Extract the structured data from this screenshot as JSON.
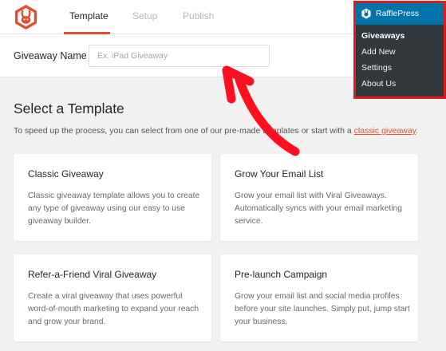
{
  "colors": {
    "accent": "#e34f2a",
    "wp_blue": "#0073aa",
    "wp_dark": "#32373c",
    "highlight_red": "#e01b1b"
  },
  "nav": {
    "tabs": [
      {
        "label": "Template",
        "active": true
      },
      {
        "label": "Setup",
        "active": false
      },
      {
        "label": "Publish",
        "active": false
      }
    ]
  },
  "name_field": {
    "label": "Giveaway Name",
    "value": "",
    "placeholder": "Ex. iPad Giveaway"
  },
  "templates": {
    "title": "Select a Template",
    "description_prefix": "To speed up the process, you can select from one of our pre-made templates or start with a",
    "description_link": "classic giveaway",
    "description_suffix": ".",
    "cards": [
      {
        "title": "Classic Giveaway",
        "description": "Classic giveaway template allows you to create any type of giveaway using our easy to use giveaway builder."
      },
      {
        "title": "Grow Your Email List",
        "description": "Grow your email list with Viral Giveaways. Automatically syncs with your email marketing service."
      },
      {
        "title": "Refer-a-Friend Viral Giveaway",
        "description": "Create a viral giveaway that uses powerful word-of-mouth marketing to expand your reach and grow your brand."
      },
      {
        "title": "Pre-launch Campaign",
        "description": "Grow your email list and social media profiles before your site launches. Simply put, jump start your business."
      }
    ]
  },
  "wp_menu": {
    "title": "RafflePress",
    "items": [
      {
        "label": "Giveaways",
        "current": true
      },
      {
        "label": "Add New",
        "current": false
      },
      {
        "label": "Settings",
        "current": false
      },
      {
        "label": "About Us",
        "current": false
      }
    ]
  },
  "icons": {
    "logo": "rafflepress-rabbit-logo",
    "menu_icon": "rafflepress-menu-icon",
    "annotation": "red-arrow"
  }
}
